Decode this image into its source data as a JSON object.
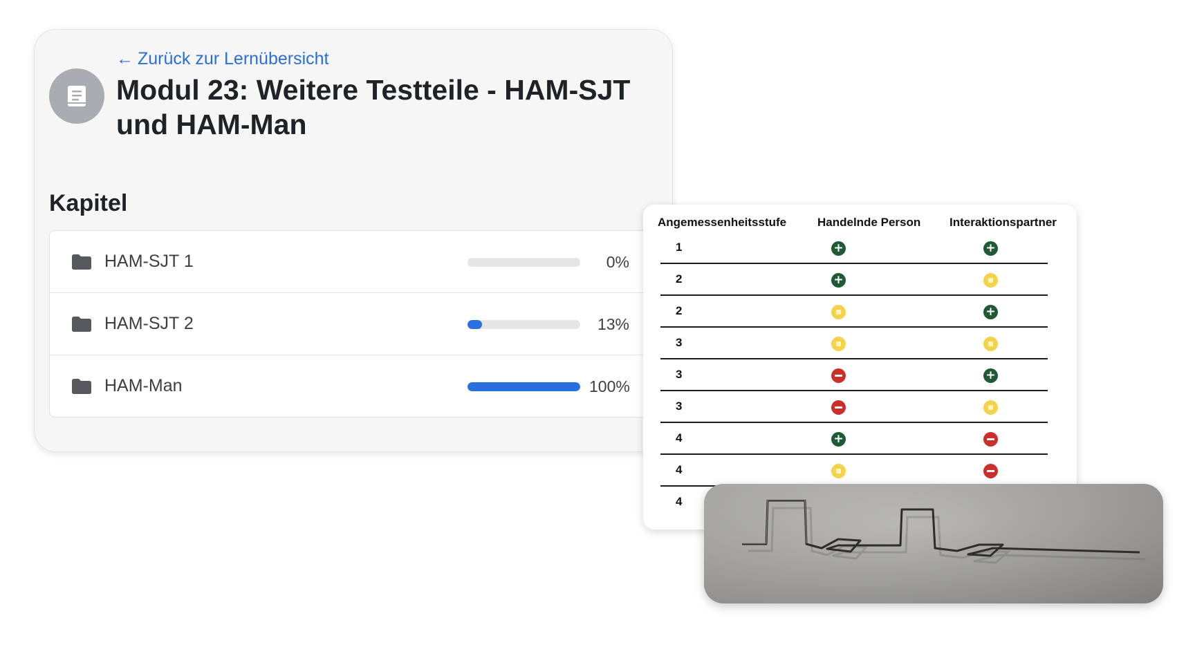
{
  "module": {
    "back_link": "Zurück zur Lernübersicht",
    "title": "Modul 23: Weitere Testteile - HAM-SJT und HAM-Man",
    "avatar_icon": "book-icon",
    "section_title": "Kapitel",
    "chapters": [
      {
        "label": "HAM-SJT 1",
        "progress": 0,
        "progress_text": "0%",
        "icon": "folder-icon"
      },
      {
        "label": "HAM-SJT 2",
        "progress": 13,
        "progress_text": "13%",
        "icon": "folder-icon"
      },
      {
        "label": "HAM-Man",
        "progress": 100,
        "progress_text": "100%",
        "icon": "folder-icon"
      }
    ],
    "accent_color": "#2a6fe0"
  },
  "table": {
    "headers": [
      "Angemessenheitsstufe",
      "Handelnde Person",
      "Interaktionspartner"
    ],
    "rows": [
      {
        "level": "1",
        "person": "plus",
        "partner": "plus"
      },
      {
        "level": "2",
        "person": "plus",
        "partner": "neutral"
      },
      {
        "level": "2",
        "person": "neutral",
        "partner": "plus"
      },
      {
        "level": "3",
        "person": "neutral",
        "partner": "neutral"
      },
      {
        "level": "3",
        "person": "minus",
        "partner": "plus"
      },
      {
        "level": "3",
        "person": "minus",
        "partner": "neutral"
      },
      {
        "level": "4",
        "person": "plus",
        "partner": "minus"
      },
      {
        "level": "4",
        "person": "neutral",
        "partner": "minus"
      },
      {
        "level": "4",
        "person": "",
        "partner": ""
      }
    ],
    "badge_colors": {
      "plus": "#1f5a34",
      "minus": "#c9302c",
      "neutral": "#f3d24c"
    }
  },
  "photo": {
    "subject": "bent-wire-photo"
  }
}
